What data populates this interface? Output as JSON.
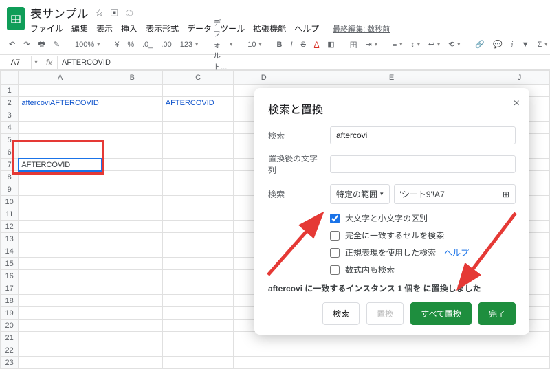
{
  "header": {
    "doc_title": "表サンプル",
    "last_edit": "最終編集: 数秒前"
  },
  "menu": {
    "file": "ファイル",
    "edit": "編集",
    "view": "表示",
    "insert": "挿入",
    "format": "表示形式",
    "data": "データ",
    "tools": "ツール",
    "extensions": "拡張機能",
    "help": "ヘルプ"
  },
  "toolbar": {
    "zoom": "100%",
    "currency": "¥",
    "percent": "%",
    "dec0": ".0_",
    "dec00": ".00",
    "num_fmt": "123",
    "font": "デフォルト...",
    "size": "10",
    "bold": "B",
    "italic": "I",
    "strike": "S",
    "underline_a": "A"
  },
  "fx": {
    "cell_ref": "A7",
    "formula": "AFTERCOVID"
  },
  "columns": [
    "A",
    "B",
    "C",
    "D",
    "E",
    "J"
  ],
  "cells": {
    "a2": "aftercoviAFTERCOVID",
    "c2": "AFTERCOVID",
    "a7": "AFTERCOVID"
  },
  "dialog": {
    "title": "検索と置換",
    "label_search": "検索",
    "input_search": "aftercovi",
    "label_replace": "置換後の文字列",
    "input_replace": "",
    "label_scope": "検索",
    "scope_select": "特定の範囲",
    "range_value": "'シート9'!A7",
    "chk_case": "大文字と小文字の区別",
    "chk_exact": "完全に一致するセルを検索",
    "chk_regex": "正規表現を使用した検索",
    "chk_formula": "数式内も検索",
    "help": "ヘルプ",
    "status_prefix": "aftercovi に一致するインスタンス 1 個を",
    "status_suffix": "に置換しました",
    "btn_find": "検索",
    "btn_replace": "置換",
    "btn_replace_all": "すべて置換",
    "btn_done": "完了"
  }
}
